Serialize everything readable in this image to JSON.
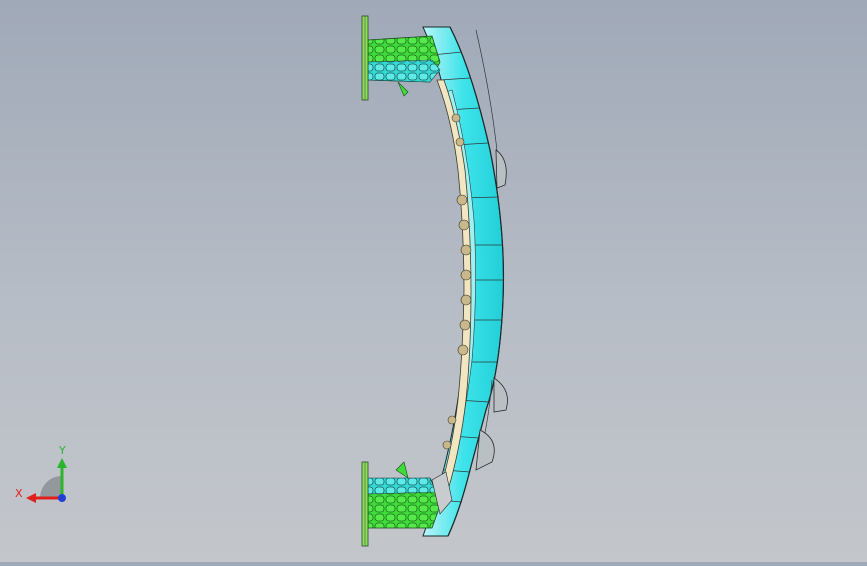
{
  "viewport": {
    "background_top": "#a0a9b8",
    "background_bottom": "#c3c6cb"
  },
  "model": {
    "colors": {
      "beam": "#33e6ec",
      "beam_light": "#a8f3f5",
      "mesh": "#3ddc3a",
      "mesh_cyan": "#3fe0da",
      "inner_strip": "#f2e6c2",
      "flange": "#7fd63c",
      "outline": "#1a2a2a"
    }
  },
  "triad": {
    "x_label": "X",
    "y_label": "Y",
    "x_color": "#e0201c",
    "y_color": "#2ab52a",
    "z_color": "#1f3fd6"
  }
}
